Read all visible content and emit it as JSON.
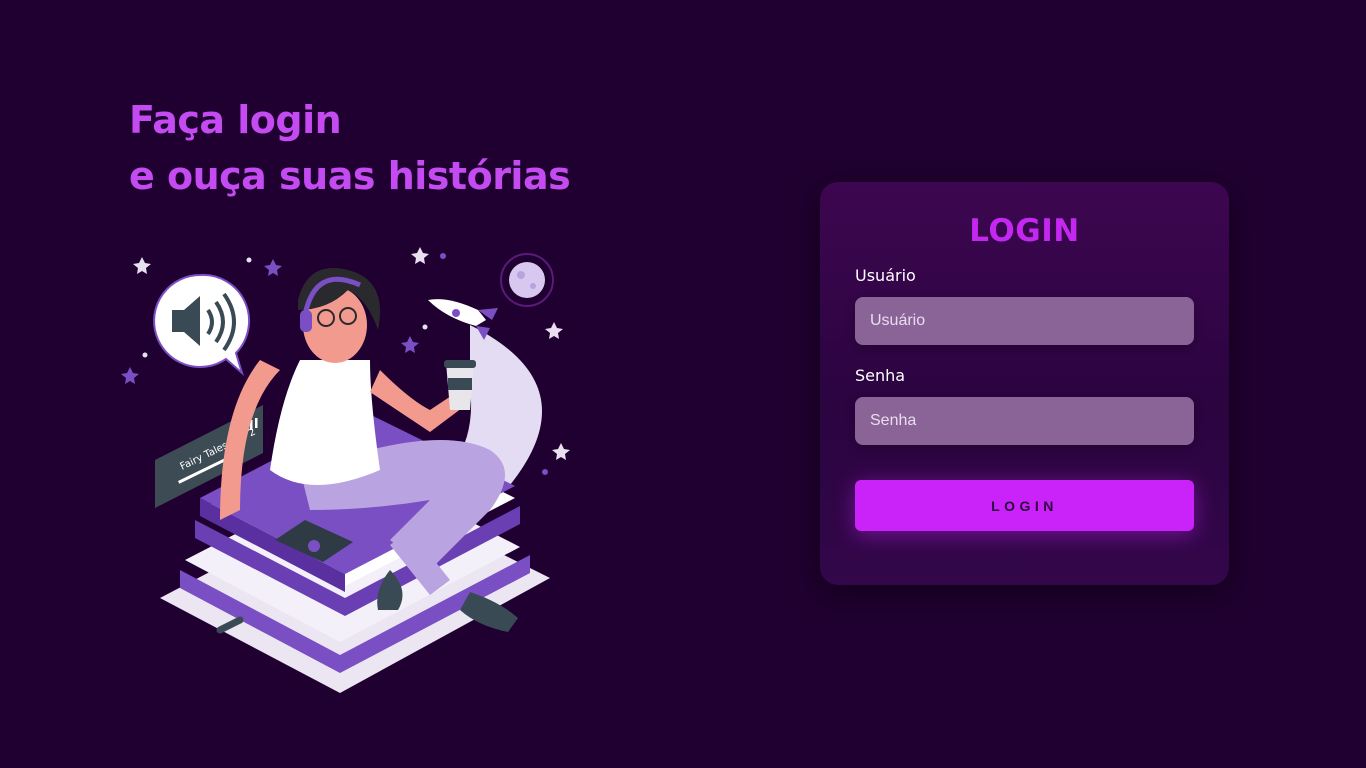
{
  "hero": {
    "line1": "Faça login",
    "line2": "e ouça suas histórias"
  },
  "illustration": {
    "player_title": "Fairy Tales Vol. 2",
    "icons": [
      "speaker-icon",
      "rocket-icon",
      "moon-icon",
      "star-icon",
      "headphones-icon",
      "coffee-cup-icon",
      "phone-icon",
      "pause-icon"
    ]
  },
  "login_card": {
    "title": "LOGIN",
    "username_label": "Usuário",
    "username_placeholder": "Usuário",
    "password_label": "Senha",
    "password_placeholder": "Senha",
    "submit_label": "LOGIN"
  },
  "colors": {
    "background": "#200030",
    "accent": "#c923fa",
    "headline": "#c44bf2",
    "input_bg": "#8a6497"
  }
}
